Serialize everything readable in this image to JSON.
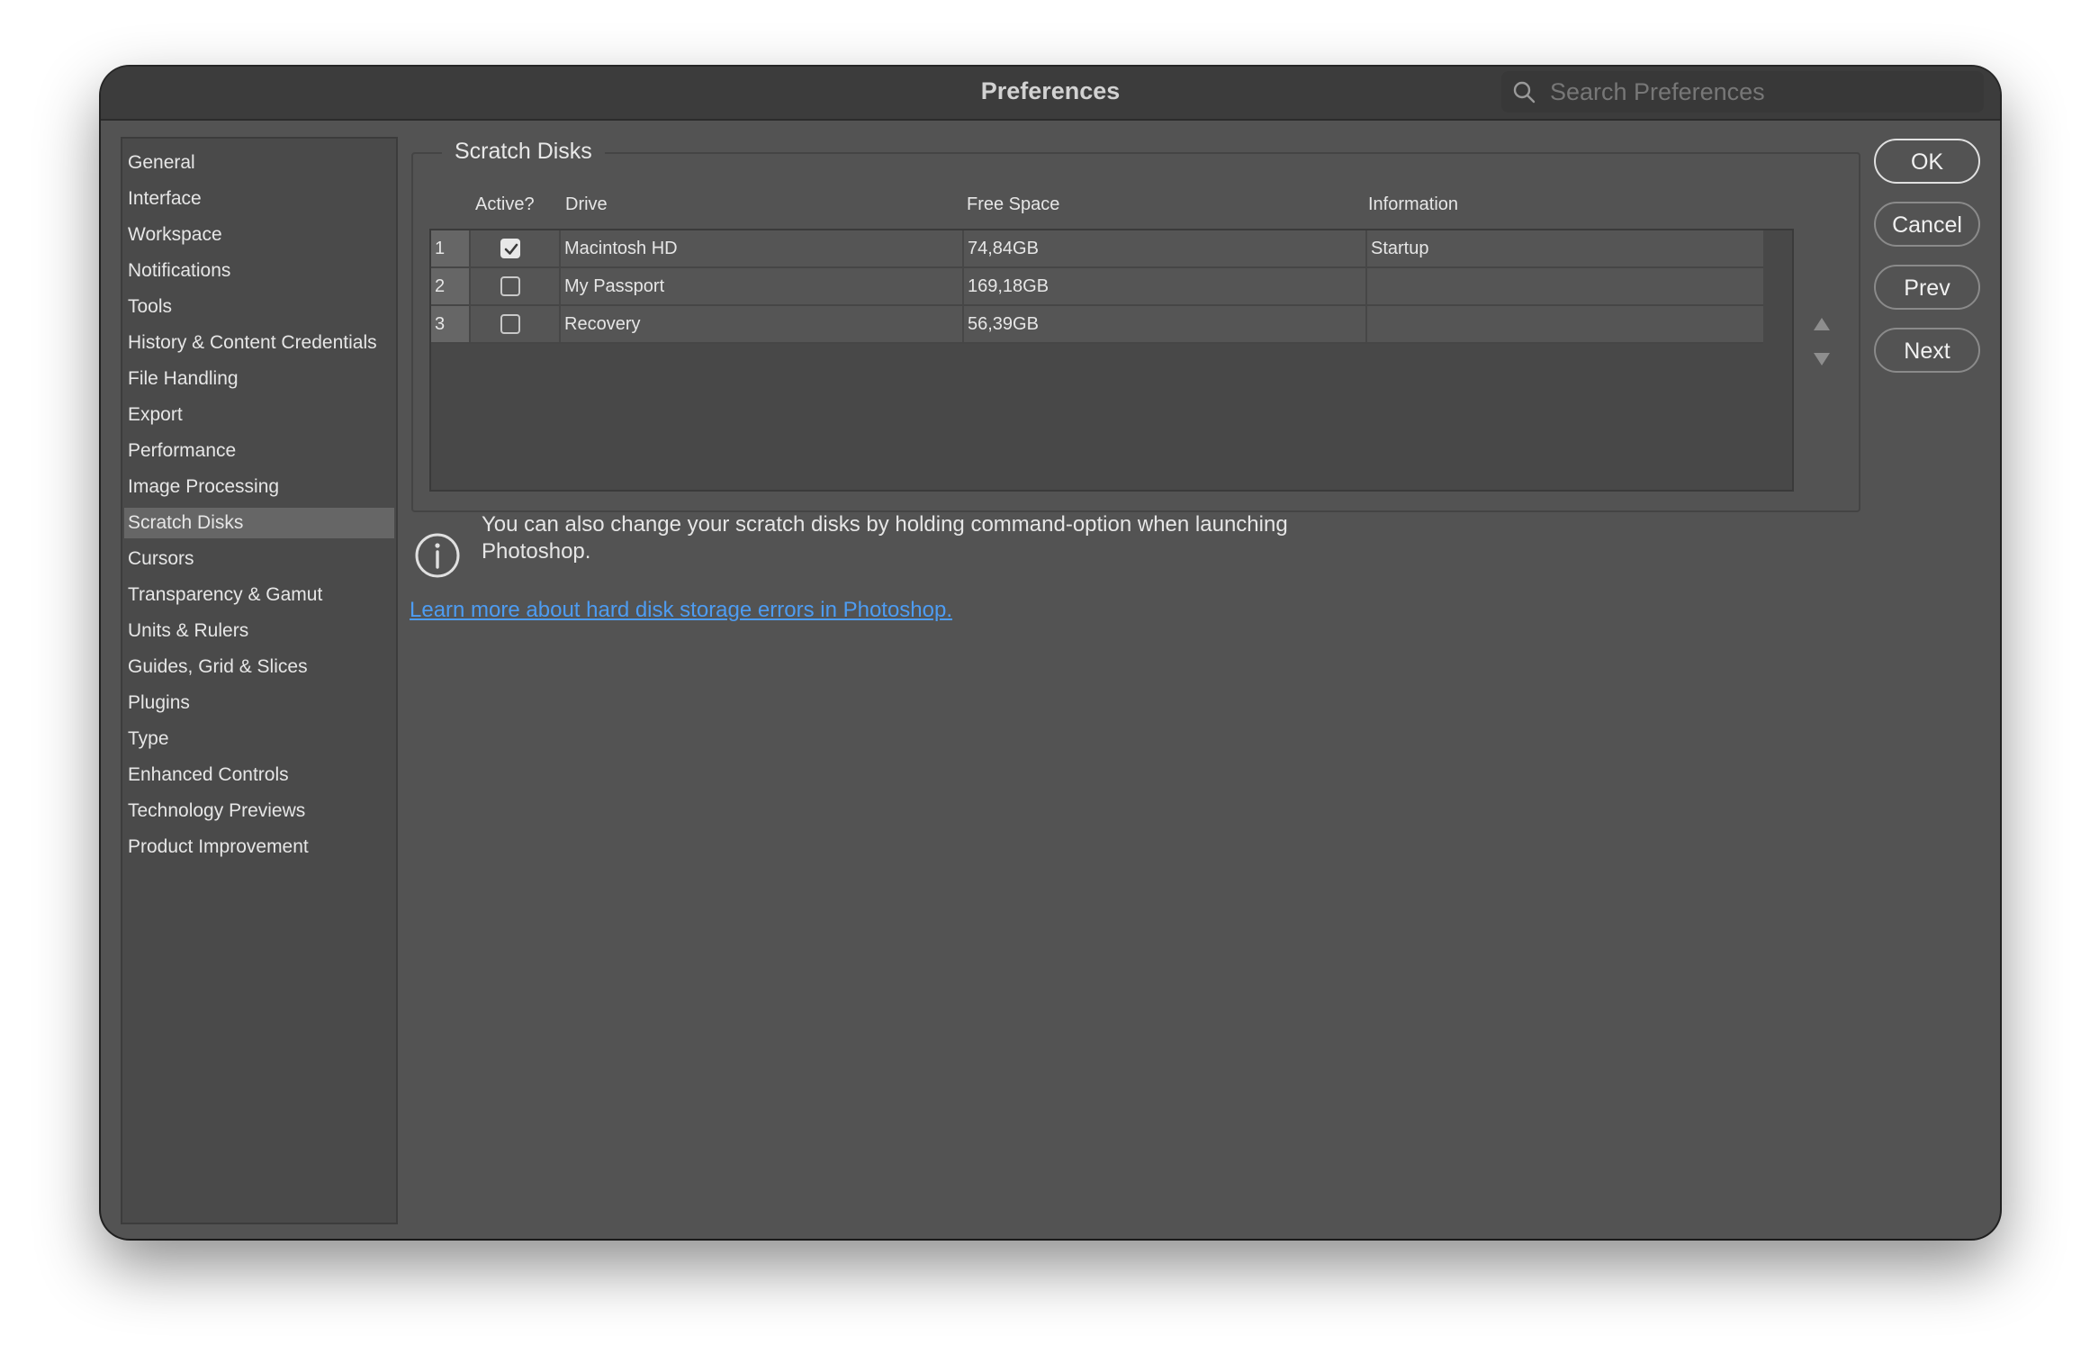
{
  "window": {
    "title": "Preferences",
    "search_placeholder": "Search Preferences"
  },
  "sidebar": {
    "selected": "Scratch Disks",
    "items": [
      "General",
      "Interface",
      "Workspace",
      "Notifications",
      "Tools",
      "History & Content Credentials",
      "File Handling",
      "Export",
      "Performance",
      "Image Processing",
      "Scratch Disks",
      "Cursors",
      "Transparency & Gamut",
      "Units & Rulers",
      "Guides, Grid & Slices",
      "Plugins",
      "Type",
      "Enhanced Controls",
      "Technology Previews",
      "Product Improvement"
    ]
  },
  "scratch_disks": {
    "title": "Scratch Disks",
    "columns": {
      "active": "Active?",
      "drive": "Drive",
      "free_space": "Free Space",
      "information": "Information"
    },
    "rows": [
      {
        "num": "1",
        "active": true,
        "drive": "Macintosh HD",
        "free_space": "74,84GB",
        "information": "Startup"
      },
      {
        "num": "2",
        "active": false,
        "drive": "My Passport",
        "free_space": "169,18GB",
        "information": ""
      },
      {
        "num": "3",
        "active": false,
        "drive": "Recovery",
        "free_space": "56,39GB",
        "information": ""
      }
    ],
    "info_text": "You can also change your scratch disks by holding command-option when launching Photoshop.",
    "learn_more_link": "Learn more about hard disk storage errors in Photoshop."
  },
  "buttons": {
    "ok": "OK",
    "cancel": "Cancel",
    "prev": "Prev",
    "next": "Next"
  },
  "colors": {
    "window_bg": "#535353",
    "titlebar_bg": "#3c3c3c",
    "sidebar_selected": "#666666",
    "link": "#4d9cf2"
  },
  "icons": [
    "search-icon",
    "checkmark-icon",
    "info-icon",
    "move-up-arrow-icon",
    "move-down-arrow-icon"
  ]
}
